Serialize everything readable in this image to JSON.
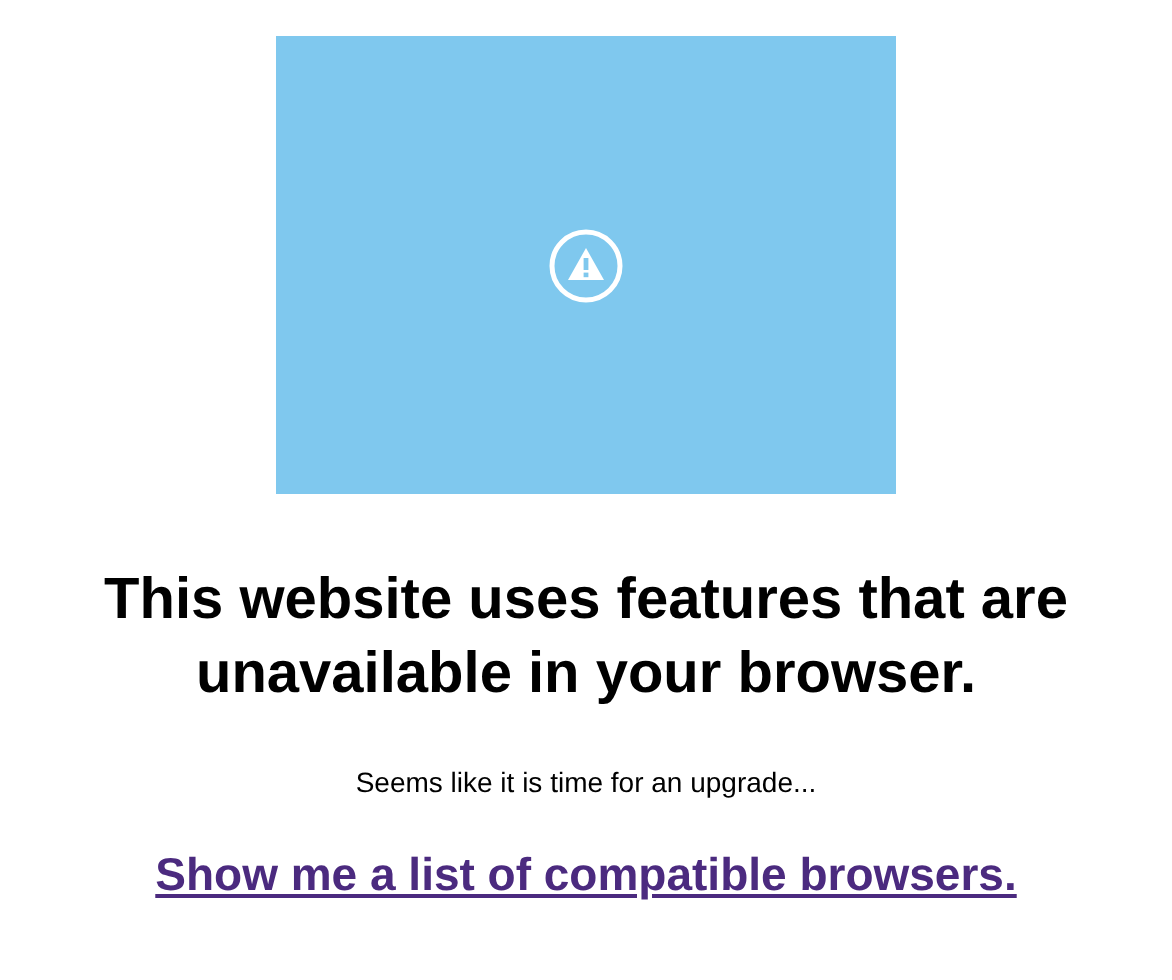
{
  "heading": "This website uses features that are unavailable in your browser.",
  "message": "Seems like it is time for an upgrade...",
  "link": "Show me a list of compatible browsers."
}
